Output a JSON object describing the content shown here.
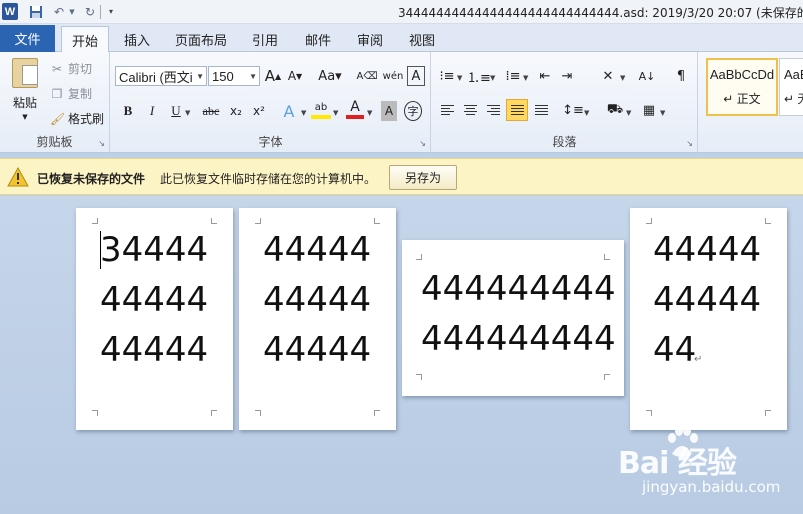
{
  "window": {
    "title": "34444444444444444444444444444.asd: 2019/3/20 20:07 (未保存的文",
    "app_icon": "W"
  },
  "quick_access": [
    "save-icon",
    "undo-icon",
    "redo-icon",
    "customize-icon"
  ],
  "tabs": {
    "file": "文件",
    "items": [
      "开始",
      "插入",
      "页面布局",
      "引用",
      "邮件",
      "审阅",
      "视图"
    ],
    "active": "开始"
  },
  "ribbon": {
    "clipboard": {
      "label": "剪贴板",
      "paste": "粘贴",
      "cut": "剪切",
      "copy": "复制",
      "format_painter": "格式刷"
    },
    "font": {
      "label": "字体",
      "font_name": "Calibri (西文i",
      "font_size": "150"
    },
    "paragraph": {
      "label": "段落"
    },
    "styles": {
      "sample": "AaBbCcDd",
      "normal": "↵ 正文",
      "sample2": "AaBb",
      "next": "↵ 无"
    }
  },
  "infobar": {
    "title": "已恢复未保存的文件",
    "message": "此已恢复文件临时存储在您的计算机中。",
    "button": "另存为"
  },
  "pages": [
    {
      "lines": [
        "34444",
        "44444",
        "44444"
      ]
    },
    {
      "lines": [
        "44444",
        "44444",
        "44444"
      ]
    },
    {
      "lines": [
        "444444444",
        "444444444"
      ]
    },
    {
      "lines": [
        "44444",
        "44444",
        "44"
      ]
    }
  ],
  "watermark": {
    "logo": "Bai  经验",
    "url": "jingyan.baidu.com"
  }
}
